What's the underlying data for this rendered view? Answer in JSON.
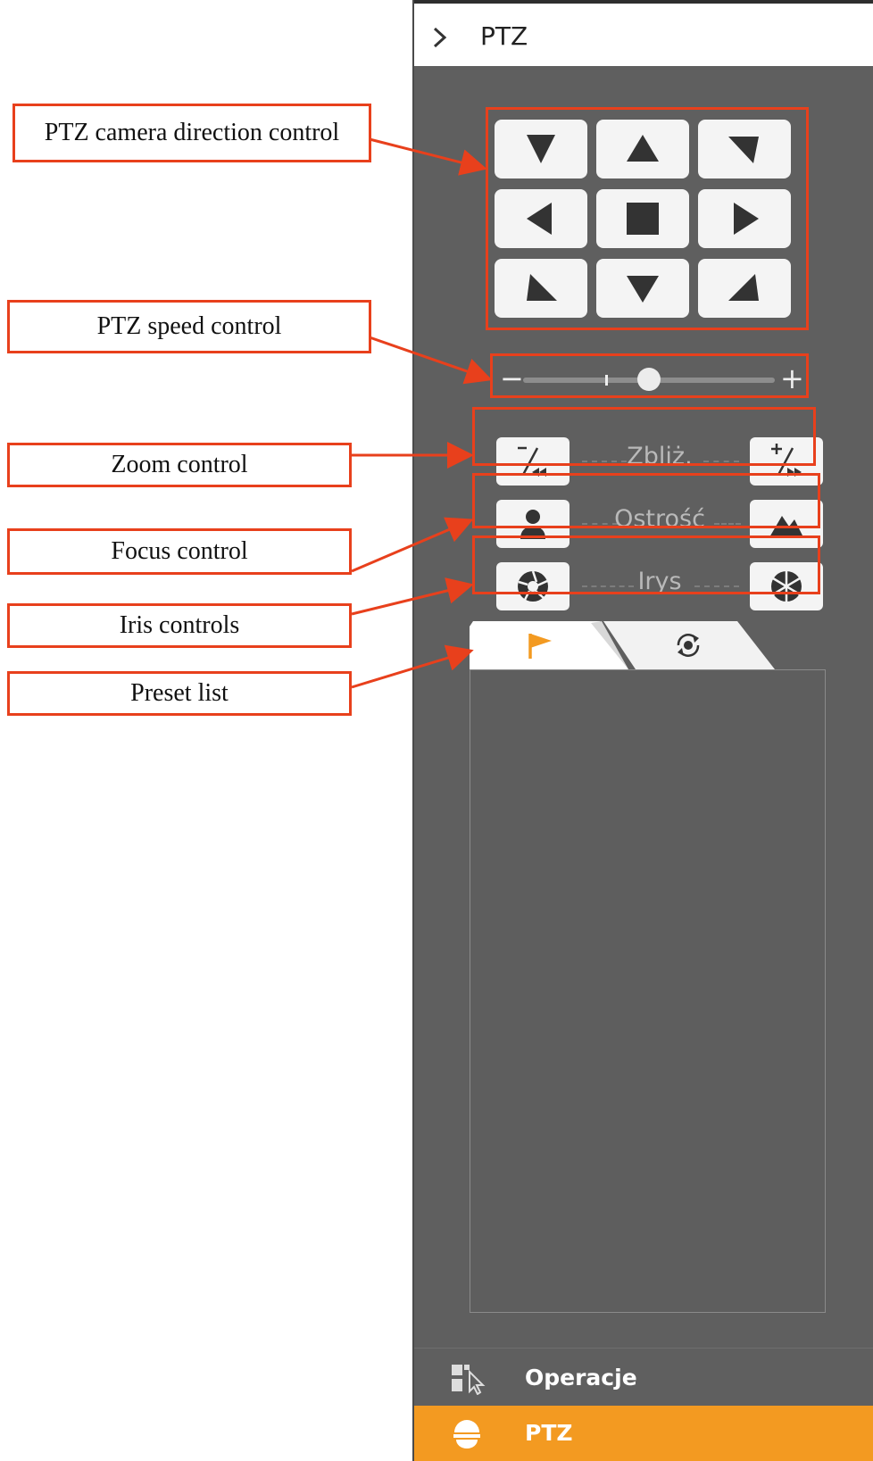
{
  "panel": {
    "header_title": "PTZ",
    "zoom_label": "Zbliż.",
    "focus_label": "Ostrość",
    "iris_label": "Irys",
    "speed_level_fraction": 0.5
  },
  "nav": {
    "operations_label": "Operacje",
    "ptz_label": "PTZ",
    "active_color": "#f39a21"
  },
  "callouts": {
    "direction": "PTZ camera direction control",
    "speed": "PTZ speed control",
    "zoom": "Zoom control",
    "focus": "Focus control",
    "iris": "Iris controls",
    "preset": "Preset list"
  },
  "colors": {
    "panel_bg": "#5f5f5f",
    "callout_border": "#e8401c",
    "preset_flag": "#f39a21"
  },
  "icons": {
    "header": "chevron-right-icon",
    "preset_tab": "flag-icon",
    "tour_tab": "rotate-icon",
    "operations": "cursor-grid-icon",
    "ptz": "dome-camera-icon"
  }
}
